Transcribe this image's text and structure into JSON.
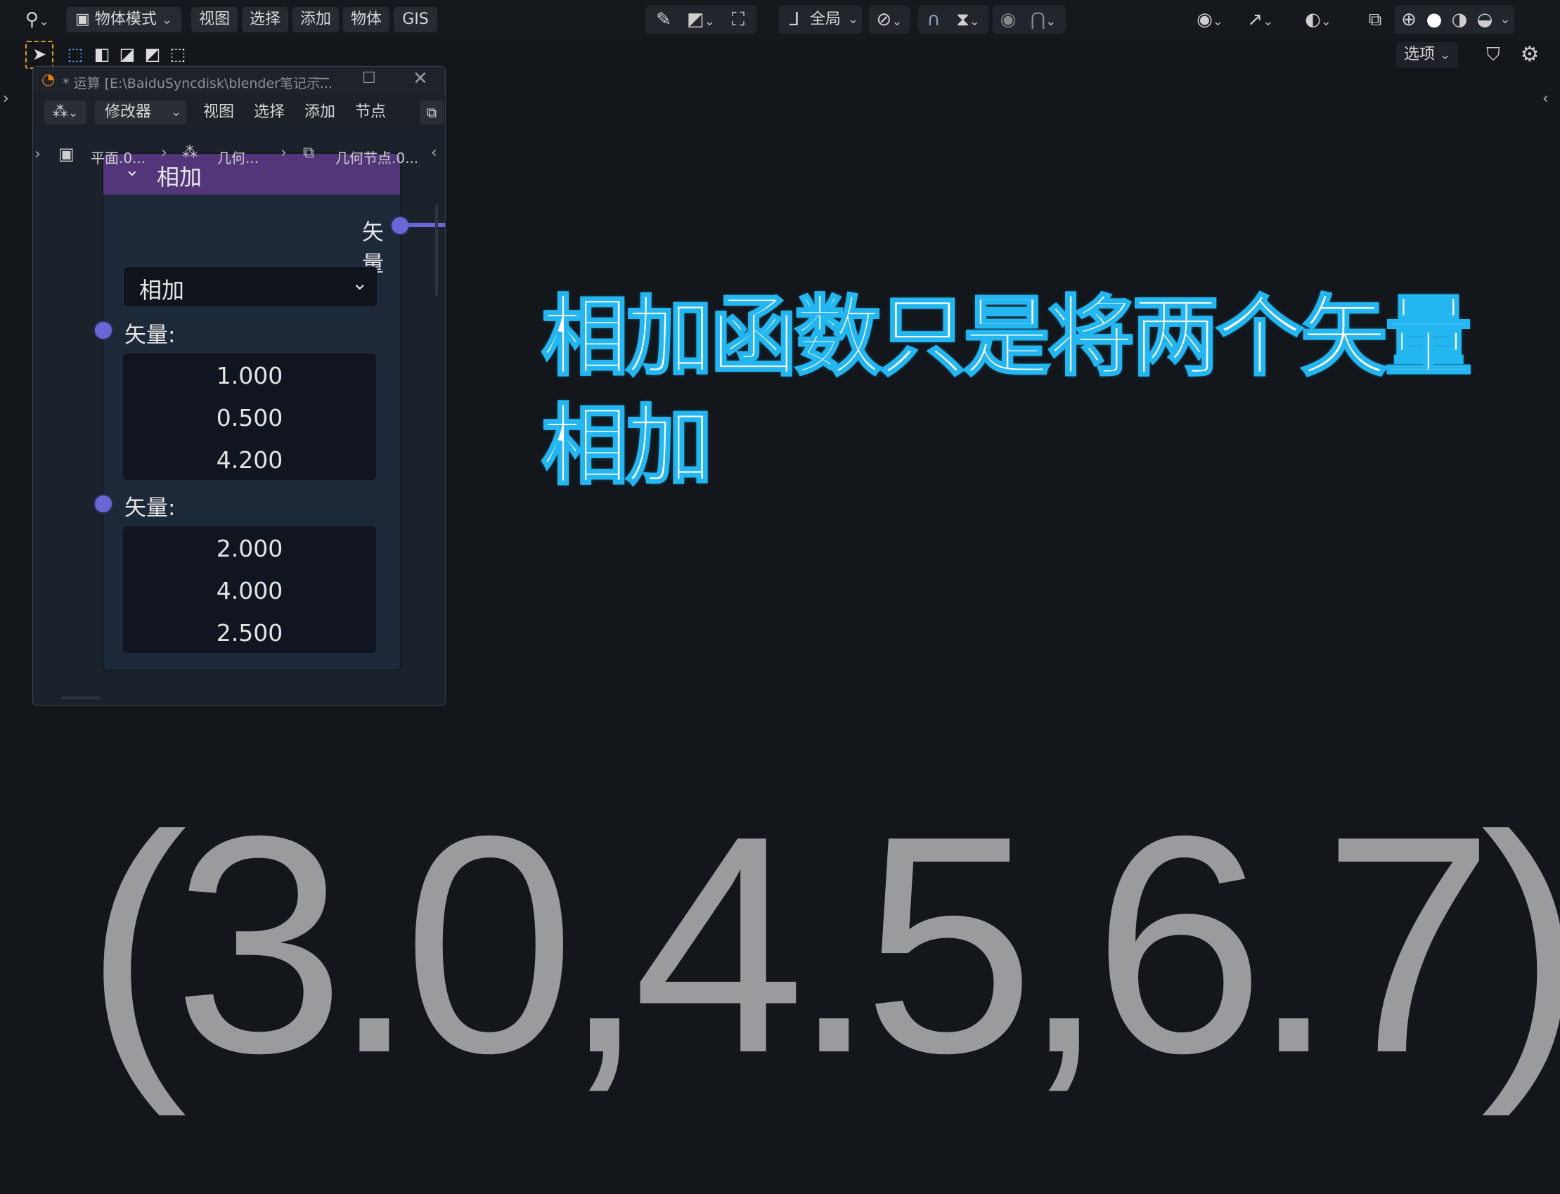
{
  "header": {
    "mode_label": "物体模式",
    "menu": [
      "视图",
      "选择",
      "添加",
      "物体",
      "GIS"
    ],
    "transform_orientation": "全局",
    "options_label": "选项"
  },
  "icons": {
    "editor_type": "editor-type-icon",
    "object_mode": "object-mode-icon",
    "eyedropper": "eyedropper-icon",
    "snap": "snap-icon",
    "proportional": "proportional-edit-icon",
    "visibility": "eye-icon",
    "gizmo": "gizmo-icon",
    "overlay": "overlay-icon",
    "xray": "xray-icon",
    "filter": "filter-icon",
    "settings": "gear-icon"
  },
  "node_window": {
    "title": "* 运算 [E:\\BaiduSyncdisk\\blender笔记示...",
    "editor_dropdown": "修改器",
    "menu": [
      "视图",
      "选择",
      "添加",
      "节点"
    ],
    "breadcrumb": [
      "平面.0...",
      "几何...",
      "几何节点.0..."
    ]
  },
  "node": {
    "header": "相加",
    "output_label": "矢量",
    "operation": "相加",
    "input1_label": "矢量:",
    "input1_values": [
      "1.000",
      "0.500",
      "4.200"
    ],
    "input2_label": "矢量:",
    "input2_values": [
      "2.000",
      "4.000",
      "2.500"
    ]
  },
  "overlay": {
    "caption_line1": "相加函数只是将两个矢量",
    "caption_line2": "相加",
    "result": "(3.0,4.5,6.7)"
  },
  "colors": {
    "background": "#13161b",
    "node_header": "#523679",
    "socket": "#6b66d6",
    "caption_outline": "#23b6f0",
    "result_text": "#9a9b9d"
  }
}
